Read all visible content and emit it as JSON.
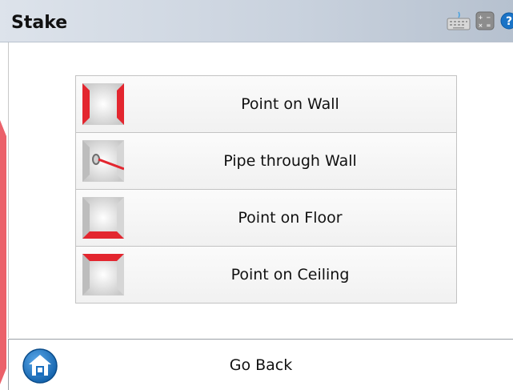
{
  "window": {
    "title": "Stake"
  },
  "menu": {
    "items": [
      {
        "label": "Point on Wall",
        "icon": "point-on-wall-icon"
      },
      {
        "label": "Pipe through Wall",
        "icon": "pipe-through-wall-icon"
      },
      {
        "label": "Point on Floor",
        "icon": "point-on-floor-icon"
      },
      {
        "label": "Point on Ceiling",
        "icon": "point-on-ceiling-icon"
      }
    ]
  },
  "footer": {
    "go_back_label": "Go Back",
    "home_icon": "home-icon"
  },
  "colors": {
    "accent_red": "#e0202a",
    "header_blue": "#1a73c6"
  }
}
